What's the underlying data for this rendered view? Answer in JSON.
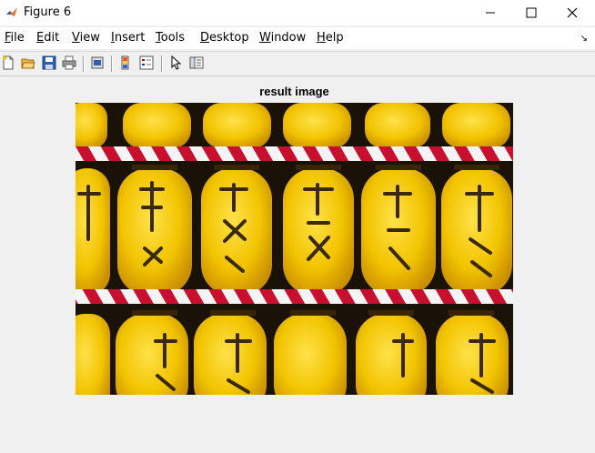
{
  "window": {
    "title": "Figure 6",
    "icon": "matlab-icon",
    "controls": [
      "minimize-icon",
      "maximize-icon",
      "close-icon"
    ]
  },
  "menubar": {
    "items": [
      "File",
      "Edit",
      "View",
      "Insert",
      "Tools",
      "Desktop",
      "Window",
      "Help"
    ],
    "dock_icon": "dock-arrow-icon",
    "dock_glyph": "↘"
  },
  "toolbar": {
    "tools": [
      "new-figure-icon",
      "open-file-icon",
      "save-icon",
      "print-icon",
      "print-preview-icon",
      "insert-colorbar-icon",
      "insert-legend-icon",
      "edit-plot-arrow-icon",
      "property-inspector-icon"
    ]
  },
  "axes": {
    "title": "result image"
  },
  "image": {
    "description_type": "photo",
    "colors": {
      "lantern": "#f2c400",
      "lantern_dark": "#c98f00",
      "stripe_red": "#c8102e",
      "background": "#1a1206"
    }
  }
}
